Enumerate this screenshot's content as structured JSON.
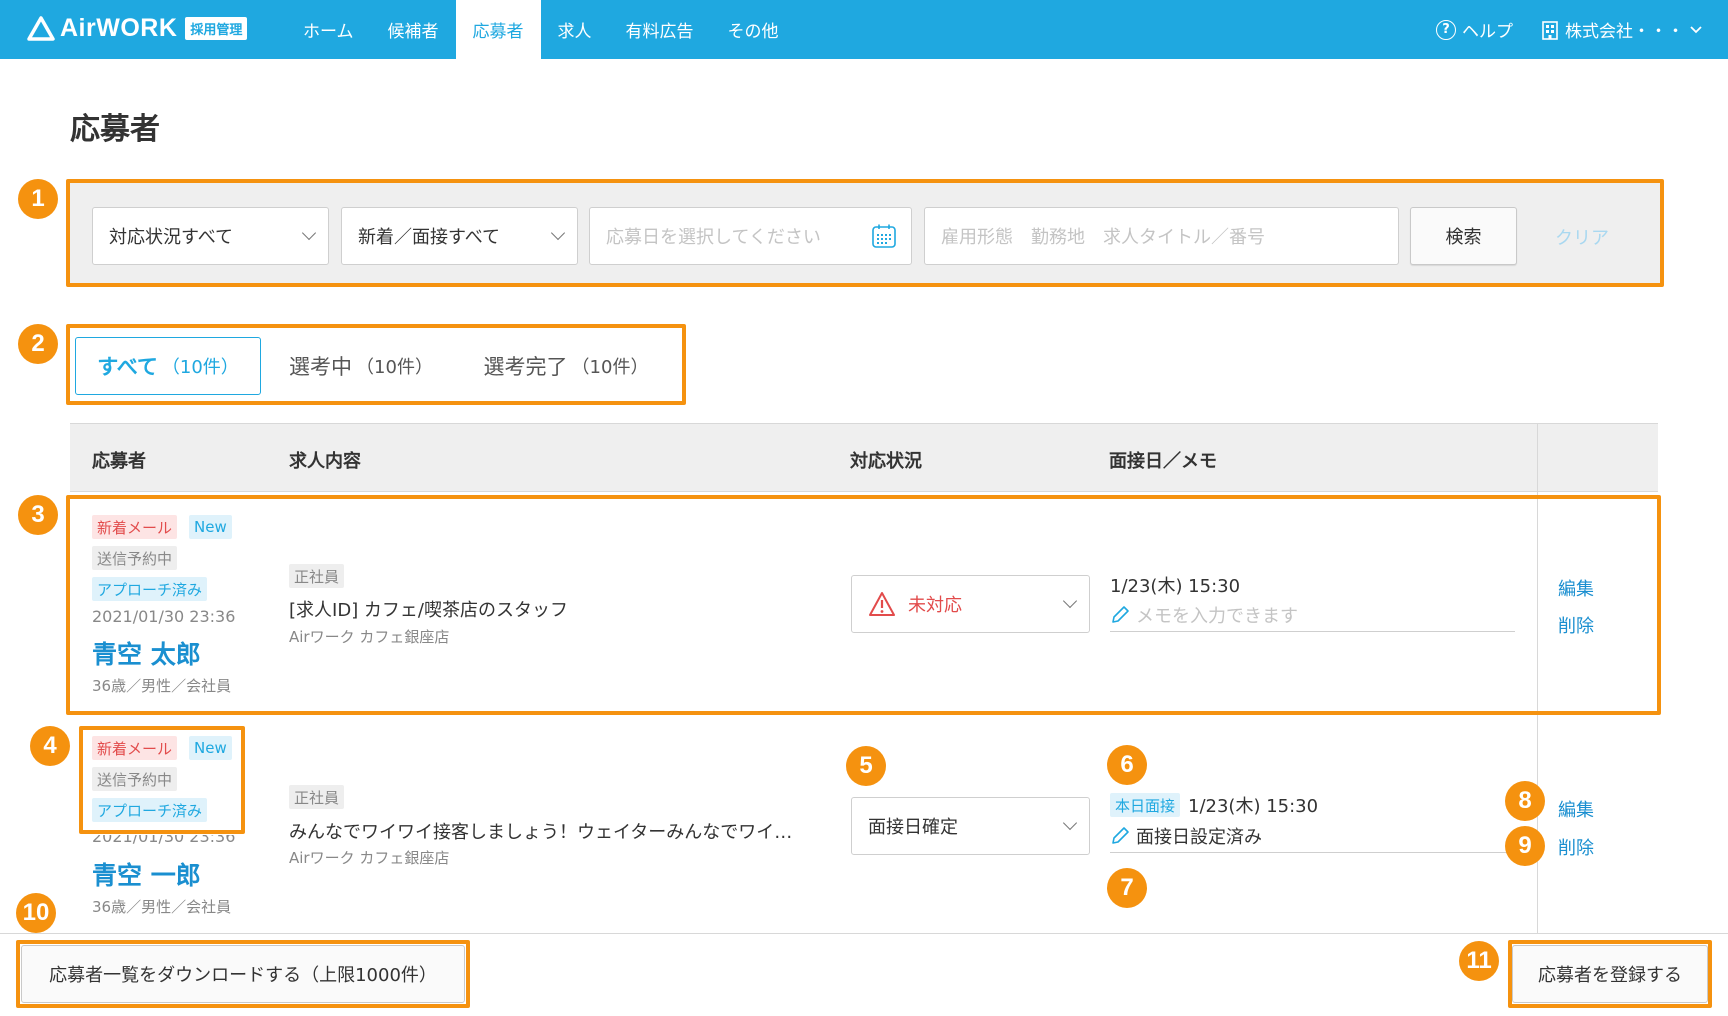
{
  "header": {
    "logo_text": "AirWORK",
    "logo_badge": "採用管理",
    "nav": [
      "ホーム",
      "候補者",
      "応募者",
      "求人",
      "有料広告",
      "その他"
    ],
    "active_nav": "応募者",
    "help_label": "ヘルプ",
    "account_label": "株式会社・・・"
  },
  "page": {
    "title": "応募者"
  },
  "filters": {
    "status_select": "対応状況すべて",
    "type_select": "新着／面接すべて",
    "date_placeholder": "応募日を選択してください",
    "keyword_placeholder": "雇用形態　勤務地　求人タイトル／番号",
    "search_button": "検索",
    "clear_link": "クリア"
  },
  "tabs": [
    {
      "label": "すべて",
      "count": "（10件）",
      "active": true
    },
    {
      "label": "選考中",
      "count": "（10件）",
      "active": false
    },
    {
      "label": "選考完了",
      "count": "（10件）",
      "active": false
    }
  ],
  "table": {
    "headers": [
      "応募者",
      "求人内容",
      "対応状況",
      "面接日／メモ"
    ],
    "rows": [
      {
        "tags": [
          "新着メール",
          "New",
          "送信予約中",
          "アプローチ済み"
        ],
        "applied_at": "2021/01/30 23:36",
        "name": "青空 太郎",
        "profile": "36歳／男性／会社員",
        "employment": "正社員",
        "job_title": "[求人ID] カフェ/喫茶店のスタッフ",
        "store": "Airワーク カフェ銀座店",
        "status": "未対応",
        "interview_date": "1/23(木) 15:30",
        "memo": "メモを入力できます",
        "edit": "編集",
        "delete": "削除"
      },
      {
        "tags": [
          "新着メール",
          "New",
          "送信予約中",
          "アプローチ済み"
        ],
        "applied_at": "2021/01/30 23:36",
        "name": "青空 一郎",
        "profile": "36歳／男性／会社員",
        "employment": "正社員",
        "job_title": "みんなでワイワイ接客しましょう！ウェイターみんなでワイ…",
        "store": "Airワーク カフェ銀座店",
        "status": "面接日確定",
        "interview_badge": "本日面接",
        "interview_date": "1/23(木) 15:30",
        "memo": "面接日設定済み",
        "edit": "編集",
        "delete": "削除"
      }
    ]
  },
  "footer": {
    "download_button": "応募者一覧をダウンロードする（上限1000件）",
    "register_button": "応募者を登録する"
  },
  "callouts": [
    "1",
    "2",
    "3",
    "4",
    "5",
    "6",
    "7",
    "8",
    "9",
    "10",
    "11"
  ],
  "colors": {
    "brand": "#1fa8e0",
    "callout": "#f5920f",
    "alert": "#e24b4b"
  }
}
